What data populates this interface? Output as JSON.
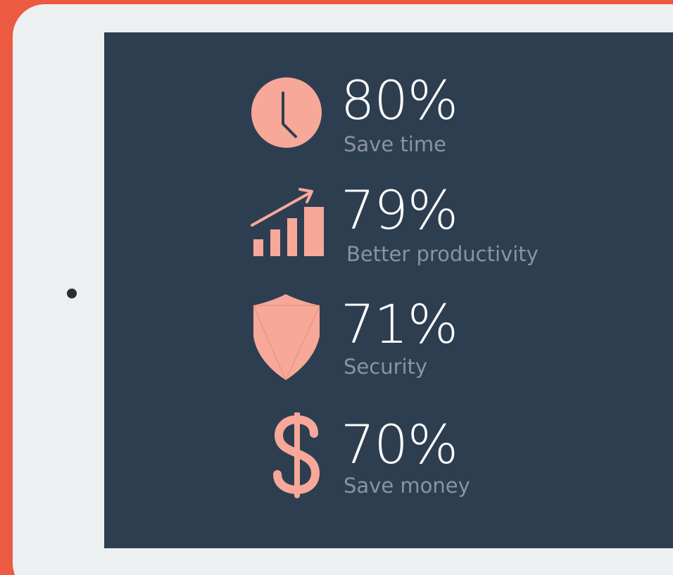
{
  "colors": {
    "frame": "#ec5a42",
    "device": "#edf0f1",
    "screen": "#2e3e51",
    "icon": "#f7a899",
    "value": "#ffffff",
    "label": "#8a93a0"
  },
  "stats": [
    {
      "icon": "clock-icon",
      "value": "80%",
      "label": "Save time"
    },
    {
      "icon": "growth-chart-icon",
      "value": "79%",
      "label": "Better productivity"
    },
    {
      "icon": "shield-icon",
      "value": "71%",
      "label": "Security"
    },
    {
      "icon": "dollar-icon",
      "value": "70%",
      "label": "Save money"
    }
  ]
}
